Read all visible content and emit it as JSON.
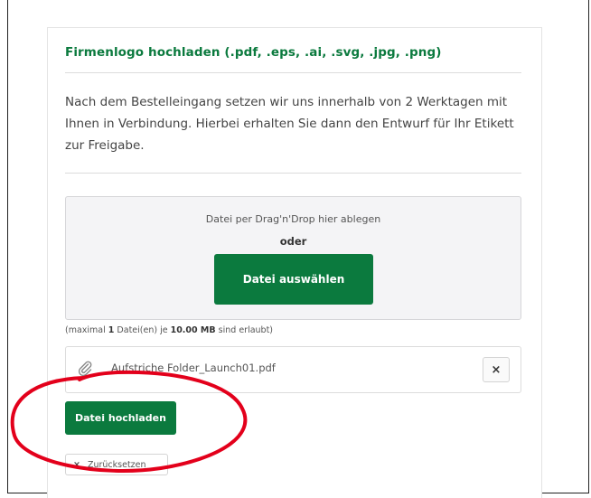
{
  "upload_section": {
    "title": "Firmenlogo hochladen (.pdf, .eps, .ai, .svg, .jpg, .png)",
    "description": "Nach dem Bestelleingang setzen wir uns innerhalb von 2 Werktagen mit Ihnen in Verbindung. Hierbei erhalten Sie dann den Entwurf für Ihr Etikett zur Freigabe."
  },
  "dropzone": {
    "hint": "Datei per Drag'n'Drop hier ablegen",
    "or": "oder",
    "select_button": "Datei auswählen"
  },
  "limit": {
    "prefix": "(maximal ",
    "count": "1",
    "middle": " Datei(en) je ",
    "size": "10.00 MB",
    "suffix": " sind erlaubt)"
  },
  "file": {
    "name": "Aufstriche Folder_Launch01.pdf",
    "remove_label": "×",
    "icon": "paperclip-icon"
  },
  "actions": {
    "upload_button": "Datei hochladen",
    "reset_icon": "×",
    "reset_button": "Zurücksetzen"
  },
  "colors": {
    "brand_green": "#0b7a3e",
    "annotation_red": "#e3001b"
  }
}
